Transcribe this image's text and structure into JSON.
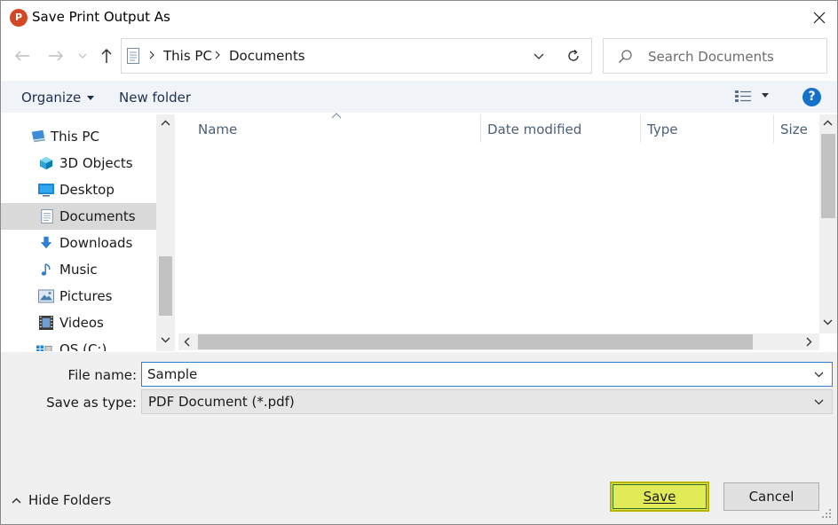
{
  "window": {
    "title": "Save Print Output As",
    "app_icon_letter": "P"
  },
  "navigation": {
    "breadcrumbs": [
      "This PC",
      "Documents"
    ],
    "search_placeholder": "Search Documents"
  },
  "commands": {
    "organize_label": "Organize",
    "new_folder_label": "New folder",
    "help_label": "?"
  },
  "nav_pane": {
    "items": [
      {
        "label": "This PC",
        "icon": "computer-icon"
      },
      {
        "label": "3D Objects",
        "icon": "cube-icon"
      },
      {
        "label": "Desktop",
        "icon": "desktop-icon"
      },
      {
        "label": "Documents",
        "icon": "document-icon",
        "selected": true
      },
      {
        "label": "Downloads",
        "icon": "download-arrow-icon"
      },
      {
        "label": "Music",
        "icon": "music-note-icon"
      },
      {
        "label": "Pictures",
        "icon": "picture-icon"
      },
      {
        "label": "Videos",
        "icon": "film-icon"
      },
      {
        "label": "OS (C:)",
        "icon": "drive-icon"
      }
    ]
  },
  "file_list": {
    "columns": [
      "Name",
      "Date modified",
      "Type",
      "Size"
    ],
    "rows": []
  },
  "form": {
    "file_name_label": "File name:",
    "file_name_value": "Sample",
    "save_type_label": "Save as type:",
    "save_type_value": "PDF Document (*.pdf)"
  },
  "footer": {
    "hide_folders_label": "Hide Folders",
    "save_label": "Save",
    "cancel_label": "Cancel"
  },
  "colors": {
    "accent": "#1470c9",
    "save_highlight": "#e1ea57",
    "selected_nav": "#d9d9d9"
  }
}
